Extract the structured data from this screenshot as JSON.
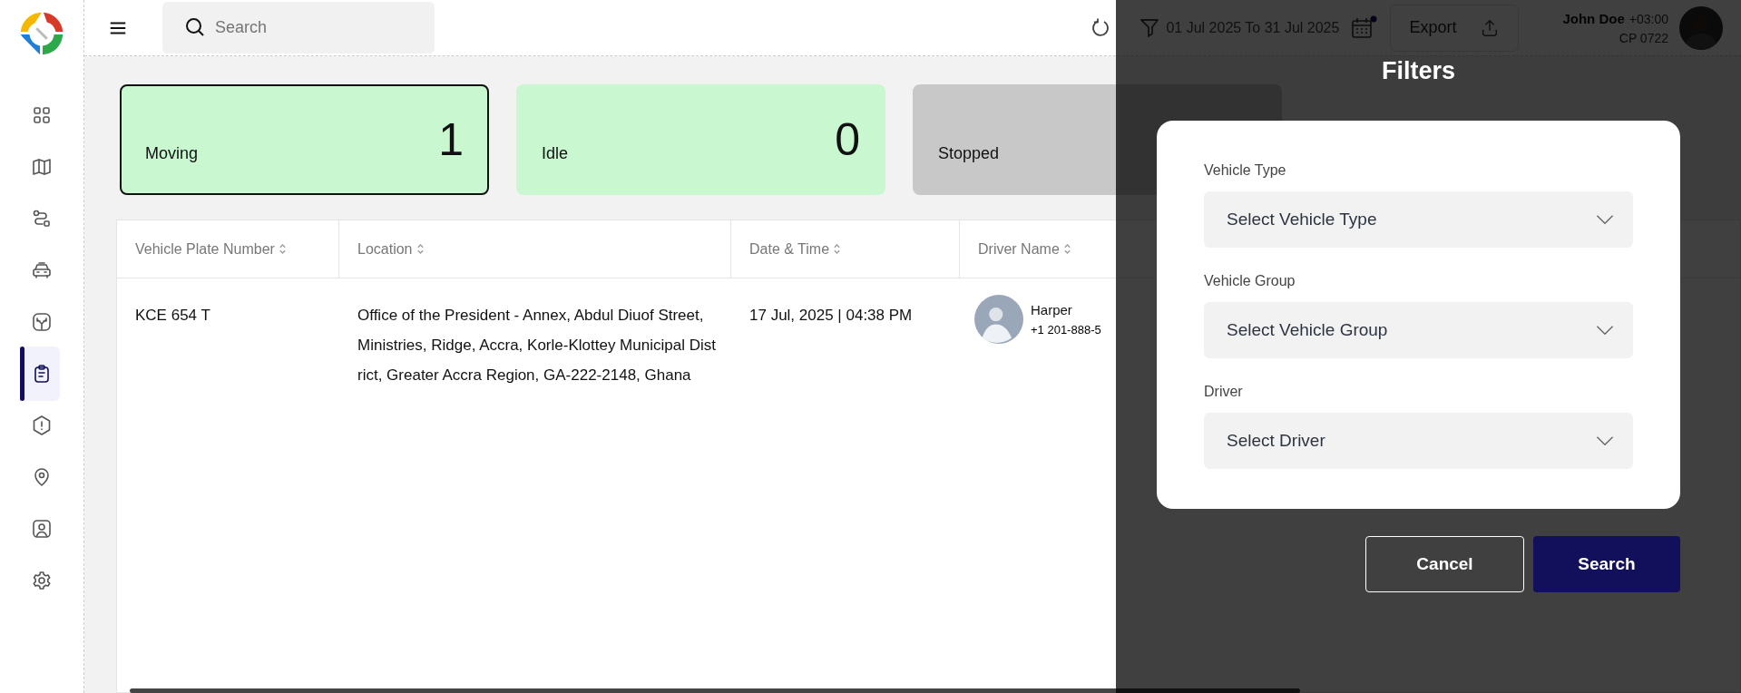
{
  "topbar": {
    "search": {
      "placeholder": "Search"
    },
    "date_range": "01 Jul 2025 To 31 Jul 2025",
    "export_button": "Export",
    "user": {
      "name": "John Doe",
      "timezone": "+03:00",
      "code": "CP 0722"
    }
  },
  "sidebar": {
    "items": [
      {
        "selected": false
      },
      {
        "selected": false
      },
      {
        "selected": false
      },
      {
        "selected": false
      },
      {
        "selected": false
      },
      {
        "selected": true
      },
      {
        "selected": false
      },
      {
        "selected": false
      },
      {
        "selected": false
      },
      {
        "selected": false
      }
    ]
  },
  "status_cards": [
    {
      "label": "Moving",
      "count": "1",
      "color": "#c8f7d0",
      "selected": true
    },
    {
      "label": "Idle",
      "count": "0",
      "color": "#c8f7d0",
      "selected": false
    },
    {
      "label": "Stopped",
      "color": "#c8c8c8",
      "selected": false
    }
  ],
  "table": {
    "columns": [
      "Vehicle Plate Number",
      "Location",
      "Date & Time",
      "Driver Name"
    ],
    "rows": [
      {
        "plate": "KCE 654 T",
        "location": "Office of the President - Annex, Abdul Diuof Street, Ministries, Ridge, Accra, Korle-Klottey Municipal District, Greater Accra Region, GA-222-2148, Ghana",
        "datetime": "17 Jul, 2025 | 04:38 PM",
        "driver": {
          "name": "Harper",
          "phone": "+1 201-888-5"
        }
      }
    ]
  },
  "filters": {
    "title": "Filters",
    "fields": [
      {
        "label": "Vehicle Type",
        "placeholder": "Select Vehicle Type"
      },
      {
        "label": "Vehicle Group",
        "placeholder": "Select Vehicle Group"
      },
      {
        "label": "Driver",
        "placeholder": "Select Driver"
      }
    ],
    "buttons": [
      {
        "label": "Cancel",
        "kind": "secondary"
      },
      {
        "label": "Search",
        "kind": "primary"
      }
    ]
  }
}
